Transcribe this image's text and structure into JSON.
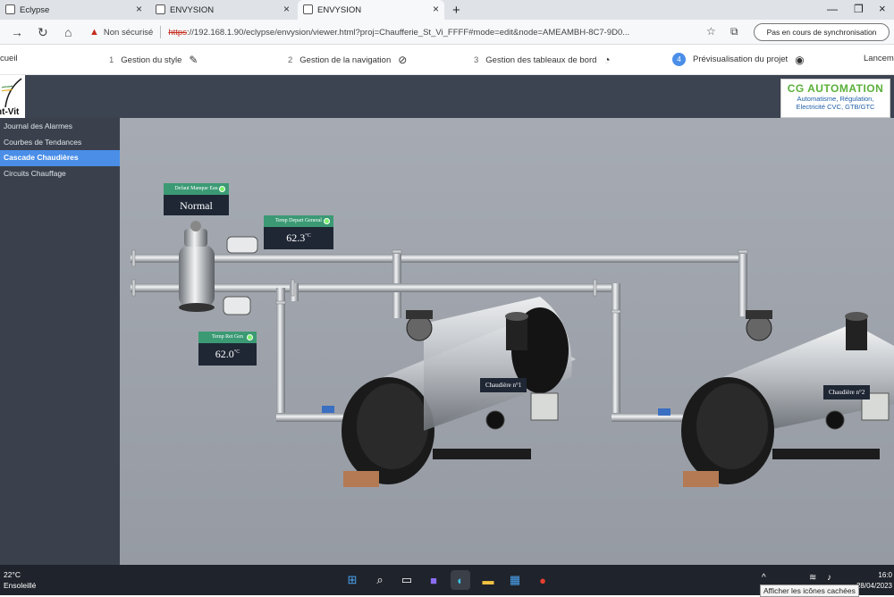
{
  "tabs": [
    {
      "label": "Eclypse",
      "active": false
    },
    {
      "label": "ENVYSION",
      "active": false
    },
    {
      "label": "ENVYSION",
      "active": true
    }
  ],
  "address": {
    "security_label": "Non sécurisé",
    "scheme": "https",
    "url_rest": "://192.168.1.90/eclypse/envysion/viewer.html?proj=Chaufferie_St_Vi_FFFF#mode=edit&node=AMEAMBH-8C7-9D0...",
    "sync_label": "Pas en cours de synchronisation"
  },
  "steps": [
    {
      "label": "cueil",
      "num": ""
    },
    {
      "label": "Gestion du style",
      "num": "1"
    },
    {
      "label": "Gestion de la navigation",
      "num": "2"
    },
    {
      "label": "Gestion des tableaux de bord",
      "num": "3"
    },
    {
      "label": "Prévisualisation du projet",
      "num": "4"
    },
    {
      "label": "Lanceme",
      "num": ""
    }
  ],
  "logo_text": "nt-Vit",
  "brand": {
    "title": "CG AUTOMATION",
    "line1": "Automatisme, Régulation,",
    "line2": "Electricité CVC, GTB/GTC"
  },
  "sidebar": {
    "items": [
      {
        "label": "Journal des Alarmes",
        "active": false
      },
      {
        "label": "Courbes de Tendances",
        "active": false
      },
      {
        "label": "Cascade Chaudières",
        "active": true
      },
      {
        "label": "Circuits Chauffage",
        "active": false
      }
    ]
  },
  "widgets": {
    "defaut": {
      "title": "Defaut Manque Eau",
      "value": "Normal"
    },
    "depart": {
      "title": "Temp Depart General",
      "value": "62.3",
      "unit": "°C"
    },
    "retour": {
      "title": "Temp Ret Gen",
      "value": "62.0",
      "unit": "°C"
    }
  },
  "boilers": {
    "b1": "Chaudière n°1",
    "b2": "Chaudière n°2"
  },
  "taskbar": {
    "temp": "22°C",
    "weather": "Ensoleillé",
    "time": "16:0",
    "date": "28/04/2023",
    "tooltip": "Afficher les icônes cachées"
  },
  "colors": {
    "accent": "#4a8ee8",
    "header": "#3c4452",
    "widget_header": "#3b9a74"
  }
}
